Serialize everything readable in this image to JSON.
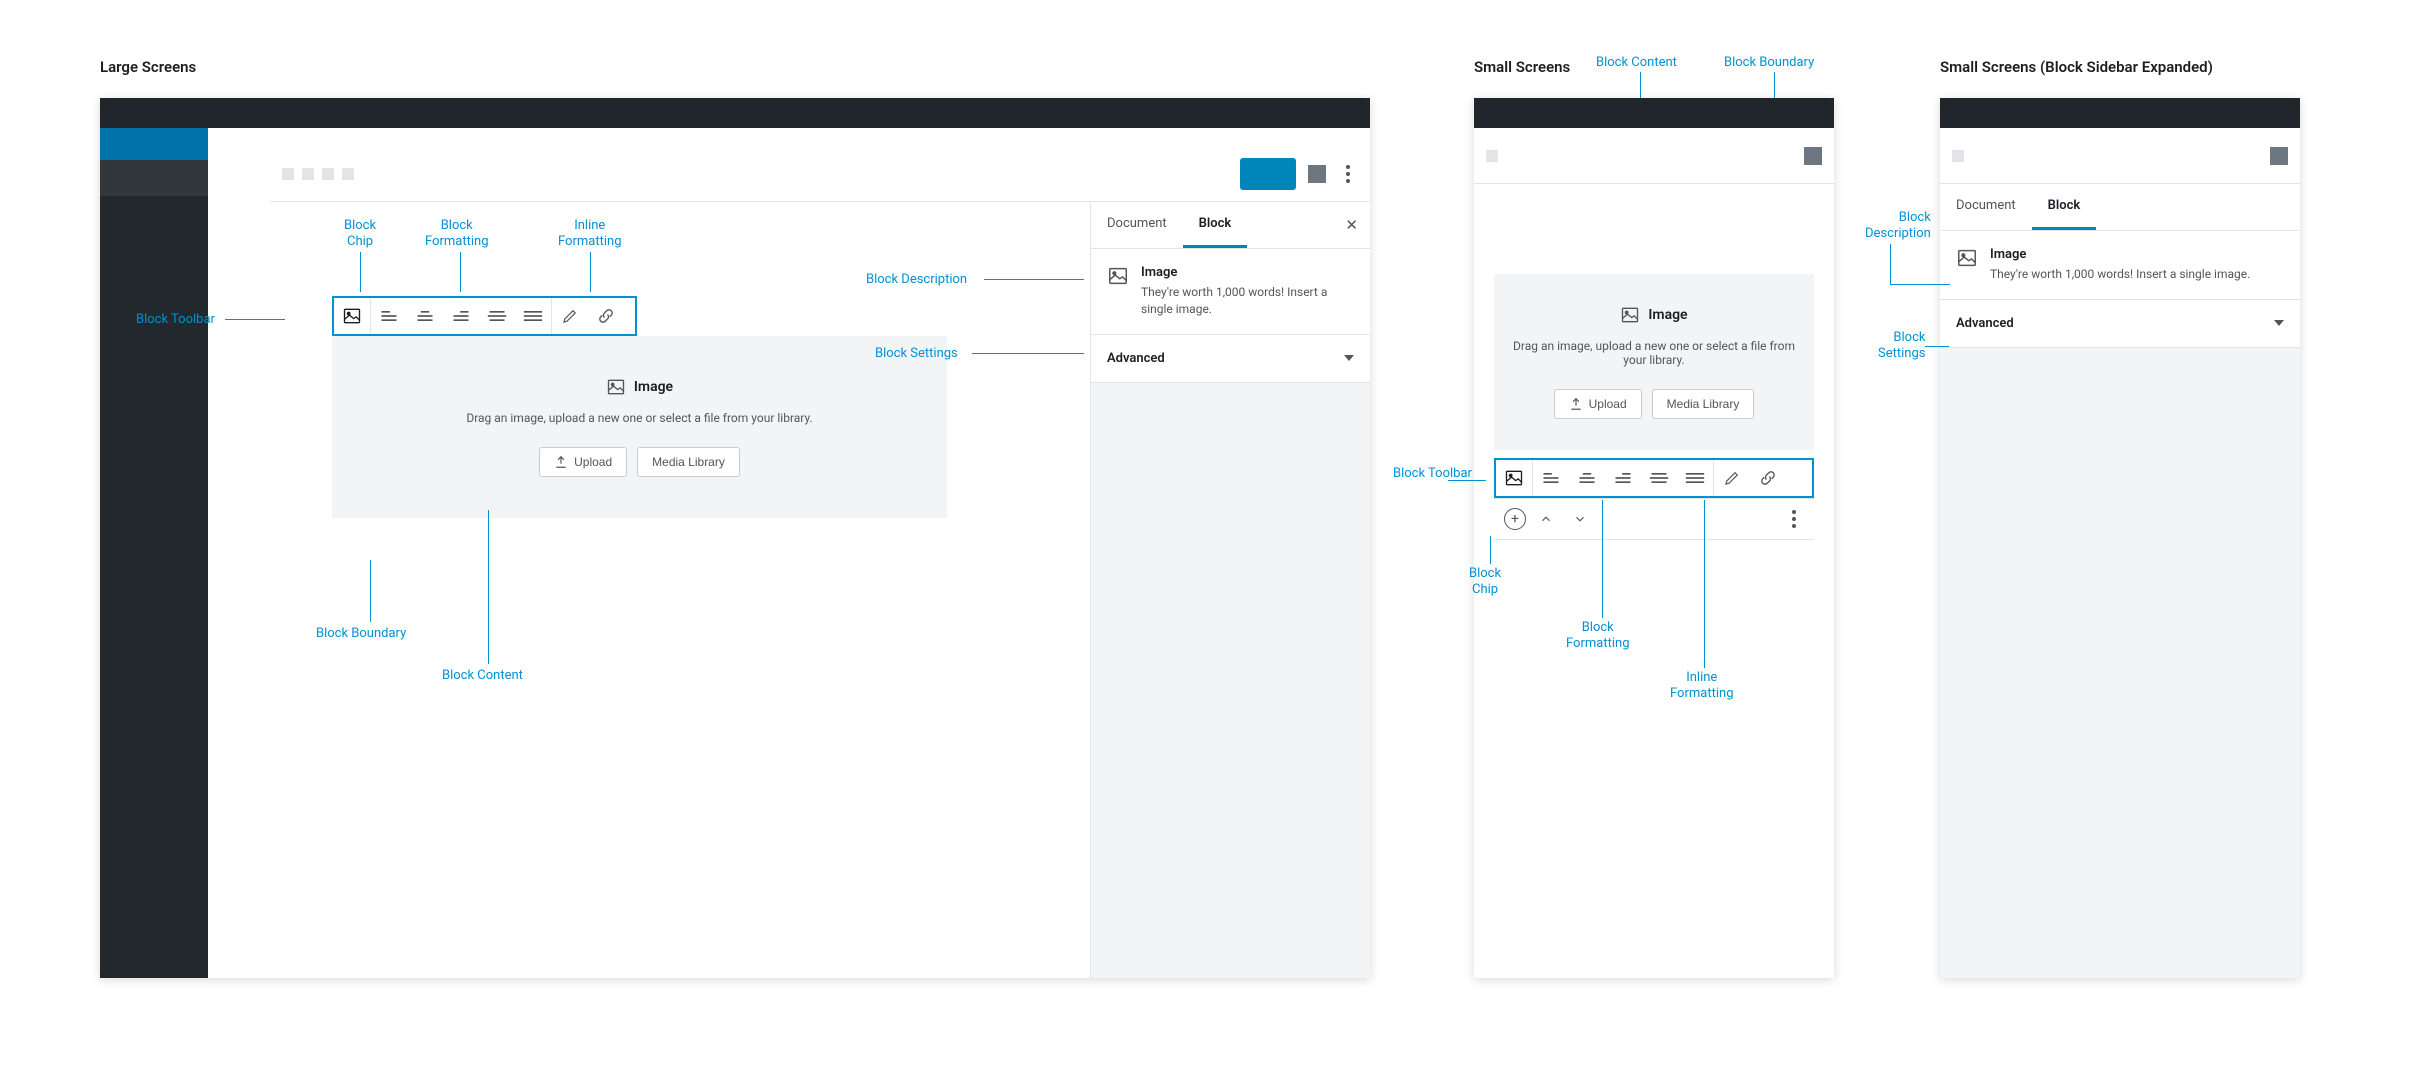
{
  "titles": {
    "large": "Large Screens",
    "small": "Small Screens",
    "small_expanded": "Small Screens (Block Sidebar Expanded)"
  },
  "callouts": {
    "block_toolbar": "Block Toolbar",
    "block_chip": "Block\nChip",
    "block_formatting": "Block\nFormatting",
    "inline_formatting": "Inline\nFormatting",
    "block_description": "Block Description",
    "block_settings": "Block Settings",
    "block_boundary": "Block Boundary",
    "block_content": "Block Content"
  },
  "sidebar": {
    "tabs": {
      "document": "Document",
      "block": "Block"
    },
    "desc_title": "Image",
    "desc_body_large": "They're worth 1,000 words! Insert a single image.",
    "desc_body_small": "They're worth 1,000 words! Insert a single image.",
    "advanced": "Advanced"
  },
  "placeholder": {
    "heading": "Image",
    "instructions_large": "Drag an image, upload a new one or select a file from your library.",
    "instructions_small": "Drag an image, upload a new one or select a file from your library.",
    "upload_btn": "Upload",
    "media_btn": "Media Library"
  }
}
